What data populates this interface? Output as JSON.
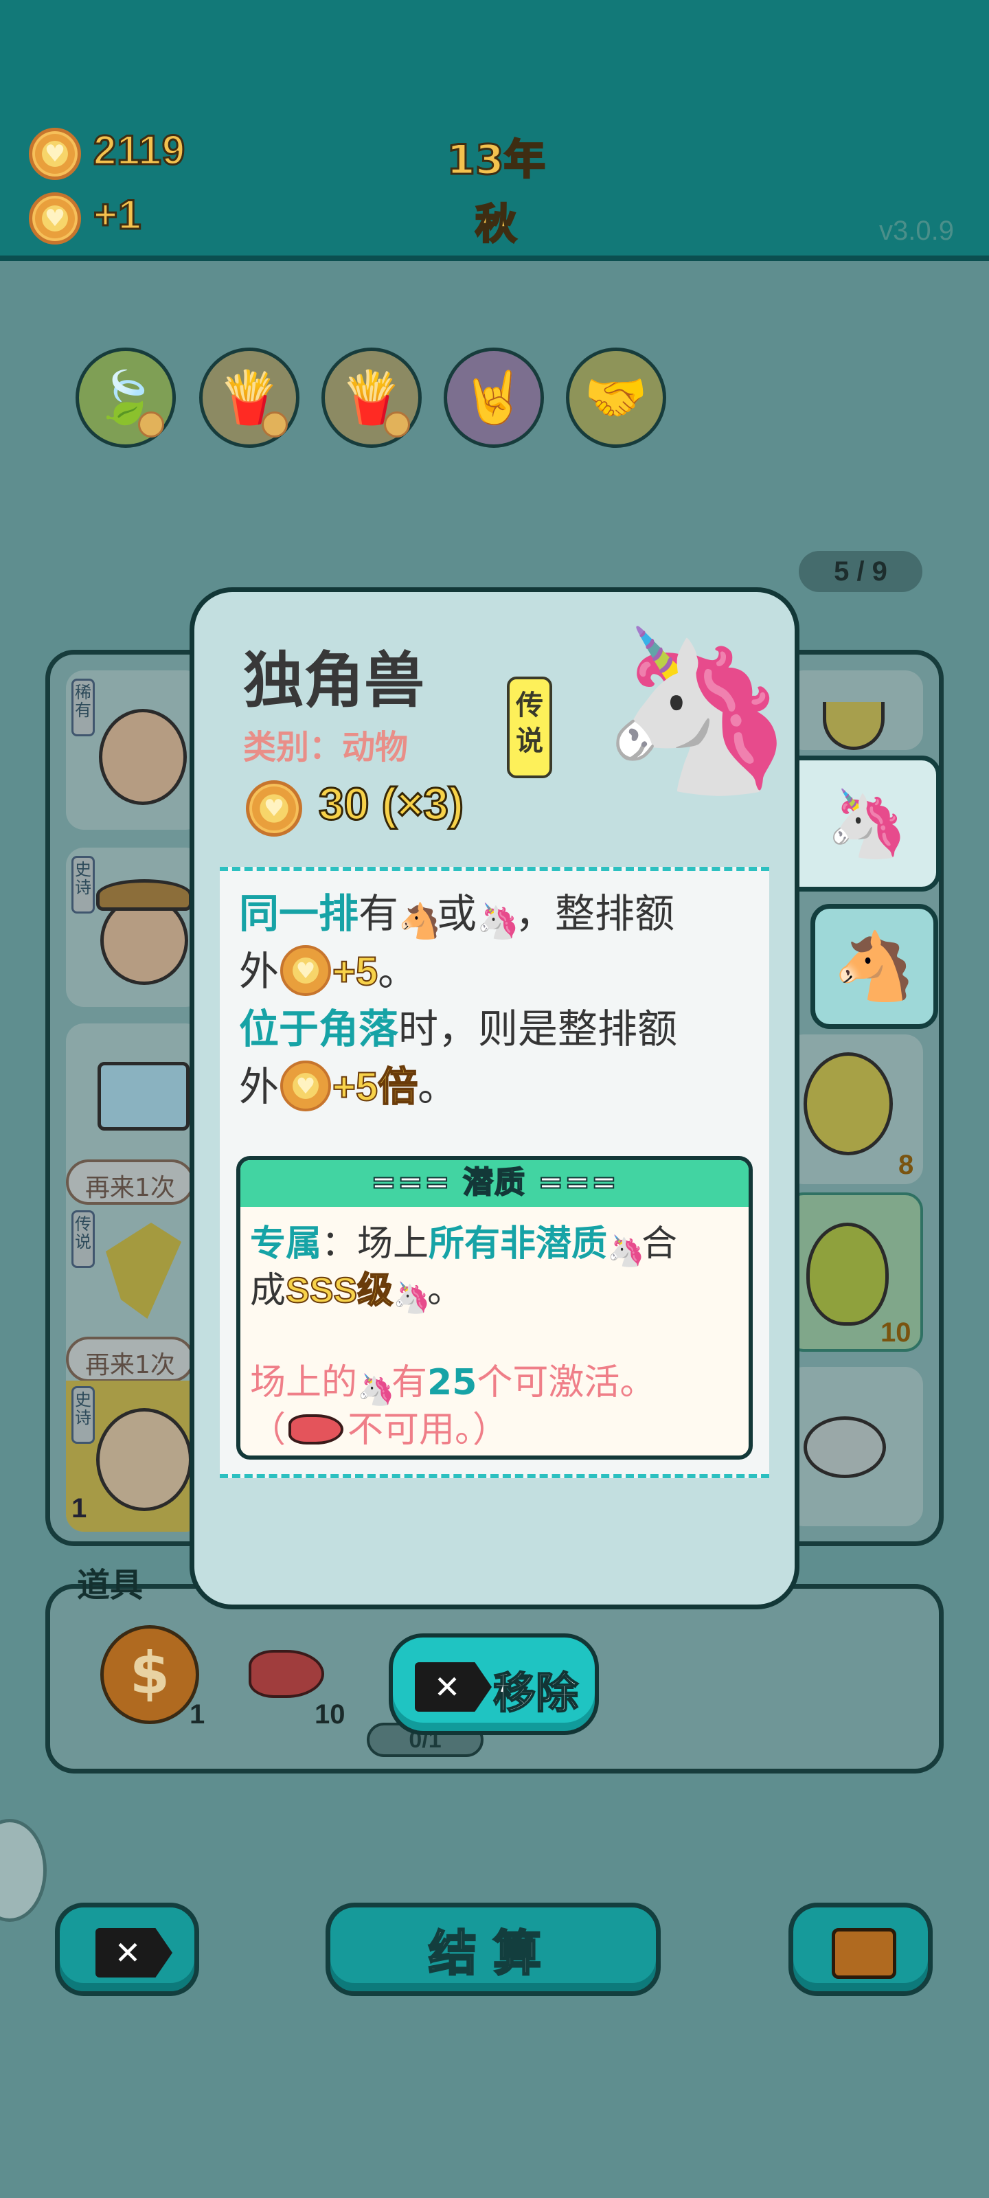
{
  "header": {
    "coins": "2119",
    "income": "+1",
    "year": "13年",
    "season": "秋",
    "version": "v3.0.9"
  },
  "perks": [
    {
      "icon": "leaf-icon",
      "glyph": "🍃",
      "bg": "#7f9f55"
    },
    {
      "icon": "fries-icon",
      "glyph": "🍟",
      "bg": "#8c8a63"
    },
    {
      "icon": "fries-icon",
      "glyph": "🍟",
      "bg": "#8c8a63"
    },
    {
      "icon": "rock-hand-icon",
      "glyph": "🤘",
      "bg": "#7c6f8f"
    },
    {
      "icon": "handshake-icon",
      "glyph": "🤝",
      "bg": "#8e9459"
    }
  ],
  "pager": "5 / 9",
  "board": {
    "tags": [
      "稀有",
      "史诗",
      "传说",
      "史诗"
    ],
    "bubbles": [
      "再来1次",
      "再来1次"
    ],
    "counts": {
      "right_mid": "8",
      "right_pear": "10",
      "bottom_left": "1"
    }
  },
  "items": {
    "label": "道具",
    "counts": [
      "1",
      "10",
      "0/1"
    ]
  },
  "popup": {
    "name": "独角兽",
    "category": "类别：动物",
    "rarity": "传说",
    "value": "30 (×3)",
    "desc": {
      "l1_a": "同一排",
      "l1_b": "有",
      "l1_c": "或",
      "l1_d": "，整排额",
      "l2_a": "外",
      "l2_b": "+5",
      "l2_c": "。",
      "l3_a": "位于角落",
      "l3_b": "时，则是整排额",
      "l4_a": "外",
      "l4_b": "+5倍",
      "l4_c": "。"
    },
    "potential": {
      "title": "===  潜质  ===",
      "l1_a": "专属",
      "l1_b": "：场上",
      "l1_c": "所有非潜质",
      "l1_d": "合",
      "l2_a": "成",
      "l2_b": "SSS级",
      "l2_c": "。",
      "l3_a": "场上的",
      "l3_b": "有",
      "l3_c": "25",
      "l3_d": "个可激活。",
      "l4_a": "（",
      "l4_b": "不可用。）"
    },
    "remove_label": "移除"
  },
  "bottom": {
    "settle_label": "结算"
  }
}
